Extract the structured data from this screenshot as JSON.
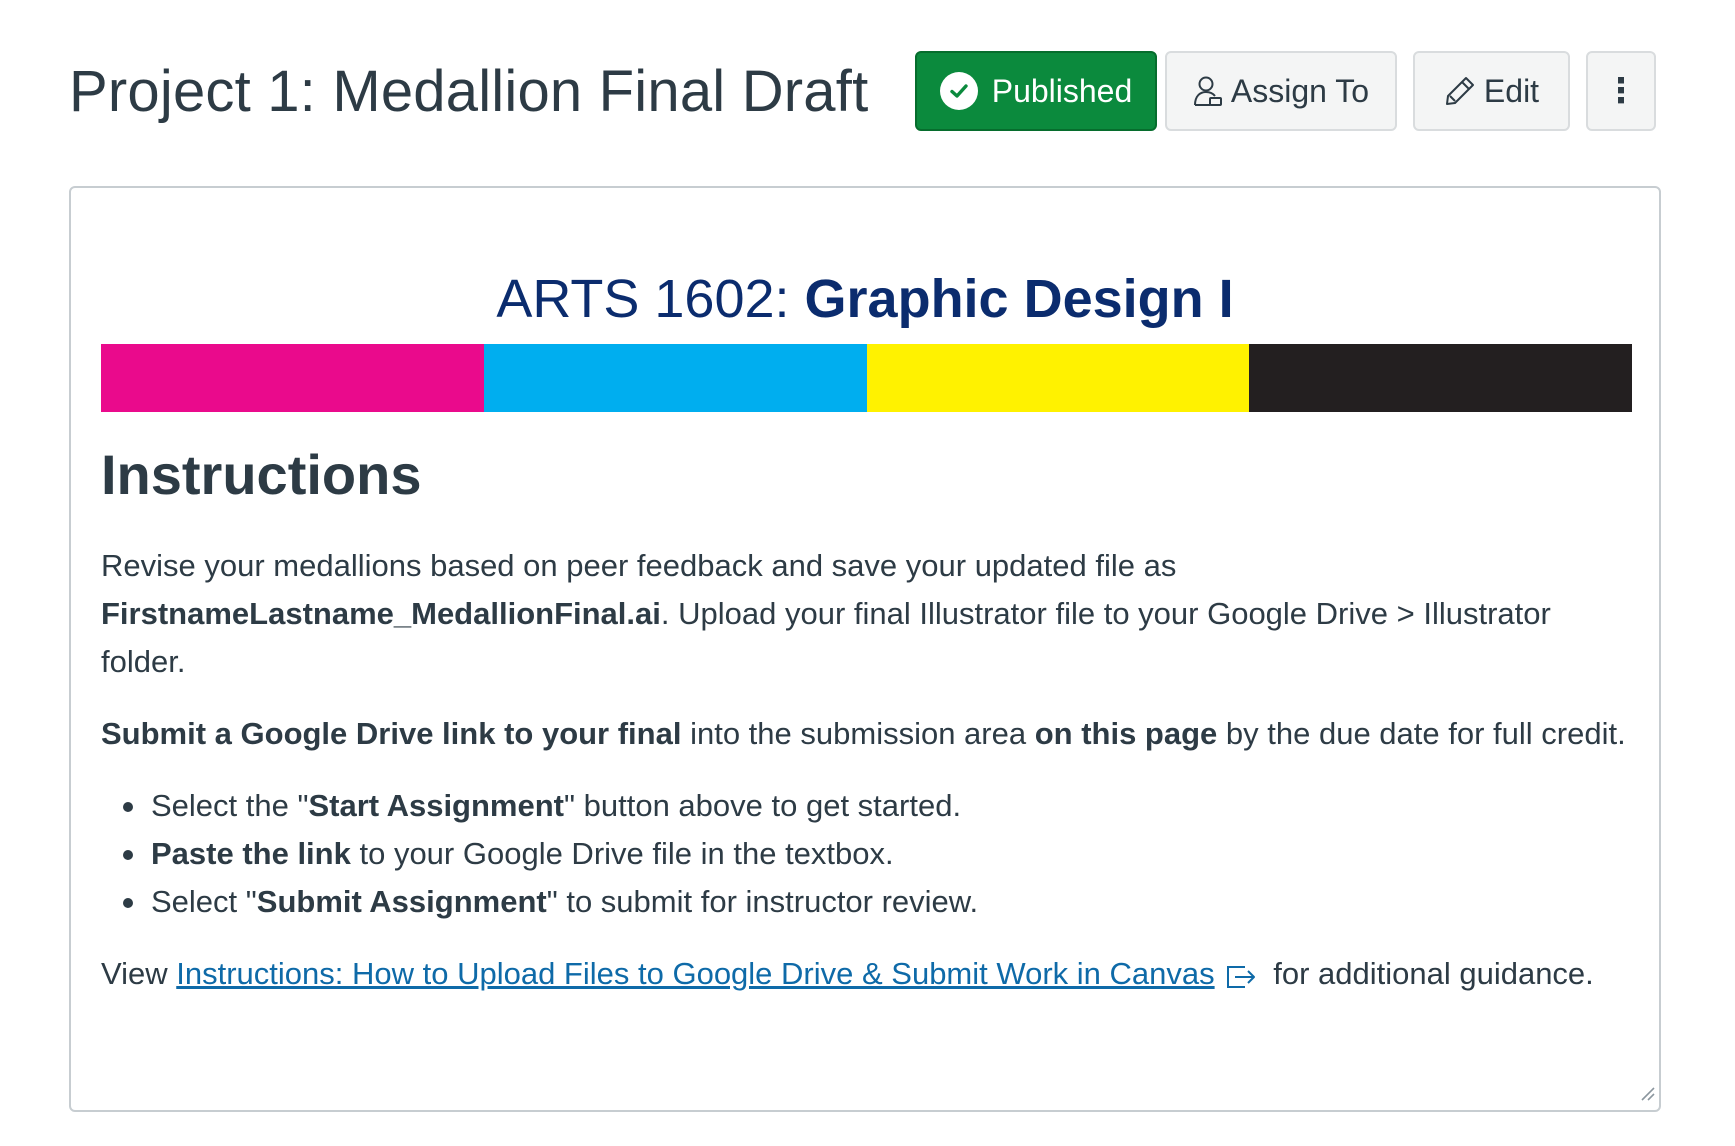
{
  "header": {
    "title": "Project 1: Medallion Final Draft",
    "published_label": "Published",
    "assign_label": "Assign To",
    "edit_label": "Edit",
    "more_label": "⋮"
  },
  "banner": {
    "course_code": "ARTS 1602: ",
    "course_name": "Graphic Design I",
    "colors": [
      "#ea0a8c",
      "#00aeef",
      "#fff200",
      "#231f20"
    ]
  },
  "instructions": {
    "heading": "Instructions",
    "p1": {
      "t1": "Revise your medallions based on peer feedback and save your updated file as ",
      "filename": "FirstnameLastname_MedallionFinal.ai",
      "t2": ". Upload your final Illustrator file to your Google Drive > Illustrator folder."
    },
    "p2": {
      "b1": "Submit a Google Drive link to your final",
      "t1": " into the submission area ",
      "b2": "on this page",
      "t2": " by the due date for full credit."
    },
    "bullets": [
      {
        "pre": "Select the \"",
        "bold": "Start Assignment",
        "post": "\" button above to get started."
      },
      {
        "pre": "",
        "bold": "Paste the link",
        "post": " to your Google Drive file in the textbox."
      },
      {
        "pre": "Select \"",
        "bold": "Submit Assignment",
        "post": "\" to submit for instructor review."
      }
    ],
    "p3": {
      "pre": "View ",
      "link_text": "Instructions: How to Upload Files to Google Drive & Submit Work in Canvas",
      "post": " for additional guidance."
    }
  },
  "colors": {
    "published_bg": "#0b8a3d",
    "heading_navy": "#0b2c6e",
    "link": "#0e6aa8",
    "text": "#2d3b45"
  }
}
